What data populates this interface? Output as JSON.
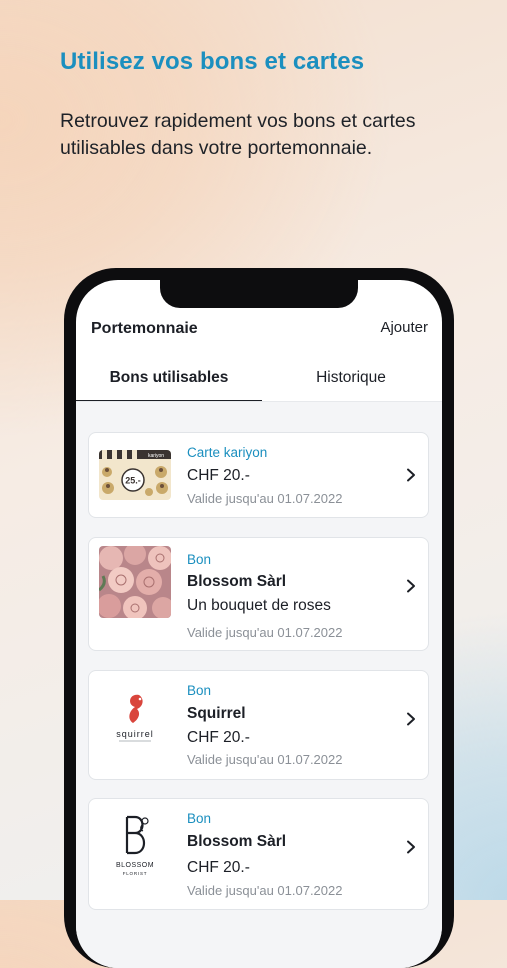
{
  "hero": {
    "title": "Utilisez vos bons et cartes",
    "subtitle": "Retrouvez rapidement vos bons et cartes utilisables dans votre portemonnaie."
  },
  "app": {
    "title": "Portemonnaie",
    "add_label": "Ajouter",
    "tabs": [
      {
        "label": "Bons utilisables",
        "active": true
      },
      {
        "label": "Historique",
        "active": false
      }
    ],
    "cards": [
      {
        "type": "Carte kariyon",
        "line1": "CHF 20.-",
        "valid": "Valide jusqu'au 01.07.2022",
        "image": "kariyon-gift-card",
        "badge": "25.-",
        "logo_text": "kariyon"
      },
      {
        "type": "Bon",
        "name": "Blossom Sàrl",
        "line1": "Un bouquet de roses",
        "valid": "Valide jusqu'au 01.07.2022",
        "image": "pink-roses-photo"
      },
      {
        "type": "Bon",
        "name": "Squirrel",
        "line1": "CHF 20.-",
        "valid": "Valide jusqu'au 01.07.2022",
        "image": "squirrel-logo",
        "logo_text": "squirrel"
      },
      {
        "type": "Bon",
        "name": "Blossom Sàrl",
        "line1": "CHF 20.-",
        "valid": "Valide jusqu'au 01.07.2022",
        "image": "blossom-florist-logo",
        "logo_text": "BLOSSOM",
        "logo_sub": "FLORIST"
      }
    ]
  },
  "colors": {
    "accent": "#1b8fbf",
    "text": "#1c1f26",
    "muted": "#8b9097"
  }
}
